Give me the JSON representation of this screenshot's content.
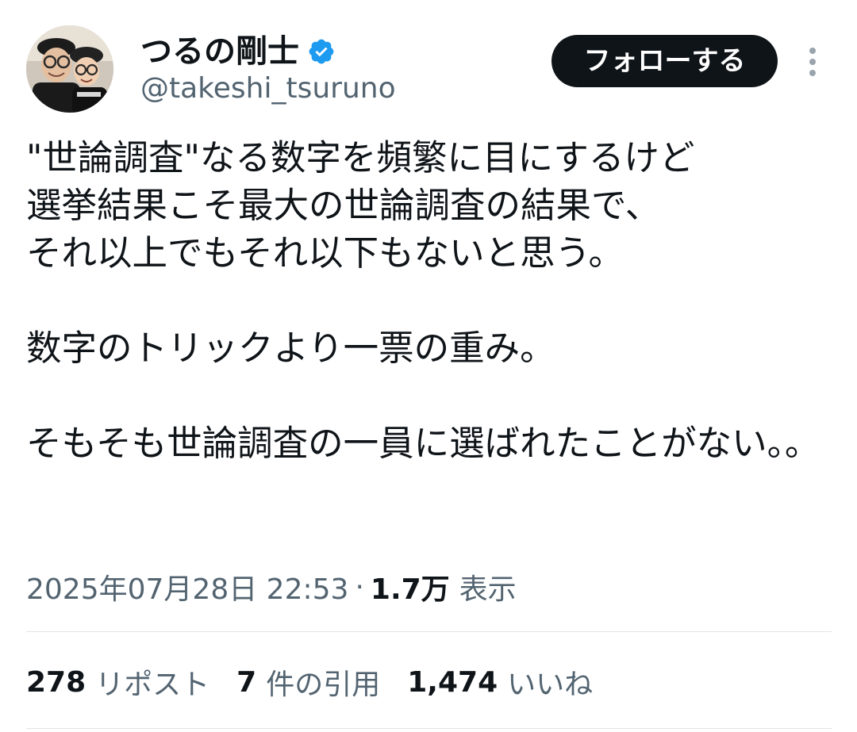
{
  "author": {
    "display_name": "つるの剛士",
    "handle": "@takeshi_tsuruno",
    "verified": true,
    "avatar_icon": "profile-photo"
  },
  "actions": {
    "follow_label": "フォローする",
    "more_icon": "more-vertical-icon"
  },
  "tweet": {
    "text": "\"世論調査\"なる数字を頻繁に目にするけど\n選挙結果こそ最大の世論調査の結果で、\nそれ以上でもそれ以下もないと思う。\n\n数字のトリックより一票の重み。\n\nそもそも世論調査の一員に選ばれたことがない。。",
    "timestamp": "2025年07月28日 22:53",
    "separator": "·",
    "views_count": "1.7万",
    "views_label": "表示"
  },
  "stats": [
    {
      "count": "278",
      "label": "リポスト"
    },
    {
      "count": "7",
      "label": "件の引用"
    },
    {
      "count": "1,474",
      "label": "いいね"
    }
  ],
  "colors": {
    "text_primary": "#0f1419",
    "text_secondary": "#536471",
    "verified_blue": "#1d9bf0",
    "follow_bg": "#0f1419",
    "divider": "#e1e4e8"
  }
}
